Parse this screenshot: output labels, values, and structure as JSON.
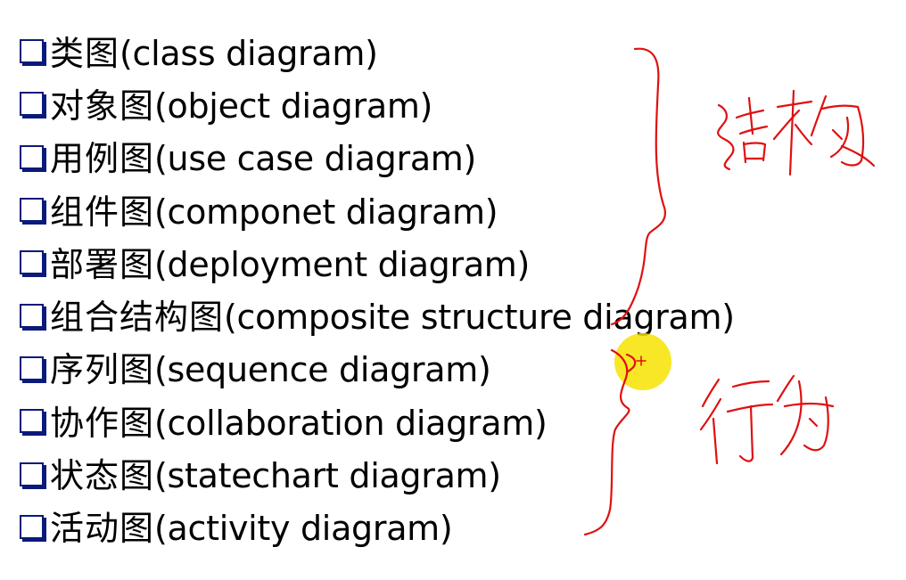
{
  "items": [
    {
      "cn": "类图",
      "en": "(class diagram)"
    },
    {
      "cn": "对象图",
      "en": "(object diagram)"
    },
    {
      "cn": "用例图",
      "en": "(use case diagram)"
    },
    {
      "cn": "组件图",
      "en": "(componet diagram)"
    },
    {
      "cn": "部署图",
      "en": "(deployment diagram)"
    },
    {
      "cn": "组合结构图",
      "en": "(composite structure diagram)"
    },
    {
      "cn": "序列图",
      "en": "(sequence diagram)"
    },
    {
      "cn": "协作图",
      "en": "(collaboration diagram)"
    },
    {
      "cn": "状态图",
      "en": "(statechart diagram)"
    },
    {
      "cn": "活动图",
      "en": "(activity diagram)"
    }
  ],
  "colors": {
    "bullet": "#0a1a7a",
    "ink": "#e01010",
    "cursor": "#f6e300"
  },
  "annotations": {
    "structure_label": "结构",
    "behavior_label": "行为"
  }
}
